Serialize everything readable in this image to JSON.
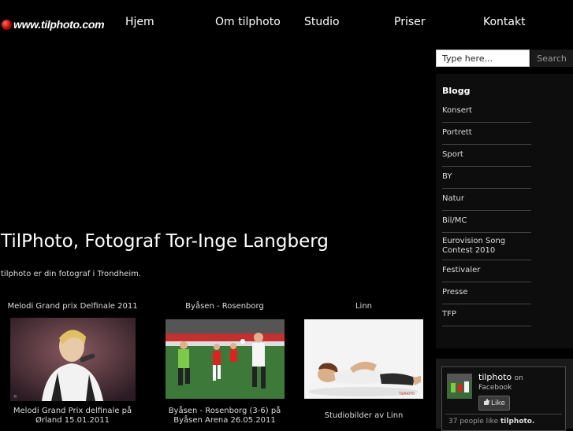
{
  "logo": {
    "text": "www.tilphoto.com"
  },
  "nav": [
    {
      "label": "Hjem"
    },
    {
      "label": "Om tilphoto"
    },
    {
      "label": "Studio"
    },
    {
      "label": "Priser"
    },
    {
      "label": "Kontakt"
    }
  ],
  "search": {
    "placeholder": "Type here...",
    "button_label": "Search"
  },
  "sidebar": {
    "title": "Blogg",
    "categories": [
      {
        "label": "Konsert"
      },
      {
        "label": "Portrett"
      },
      {
        "label": "Sport"
      },
      {
        "label": "BY"
      },
      {
        "label": "Natur"
      },
      {
        "label": "Bil/MC"
      },
      {
        "label": "Eurovision Song Contest 2010"
      },
      {
        "label": "Festivaler"
      },
      {
        "label": "Presse"
      },
      {
        "label": "TFP"
      }
    ]
  },
  "main": {
    "title": "TilPhoto, Fotograf Tor-Inge Langberg",
    "intro": "tilphoto er din fotograf i Trondheim."
  },
  "gallery": [
    {
      "title": "Melodi Grand prix Delfinale 2011",
      "caption": "Melodi Grand Prix delfinale på Ørland 15.01.2011"
    },
    {
      "title": "Byåsen - Rosenborg",
      "caption": "Byåsen - Rosenborg (3-6) på Byåsen Arena 26.05.2011"
    },
    {
      "title": "Linn",
      "caption": "Studiobilder av Linn"
    }
  ],
  "facebook": {
    "page_name": "tilphoto",
    "on_text": "on",
    "network": "Facebook",
    "like_label": "Like",
    "count_text": "37 people like",
    "count_name": "tilphoto."
  }
}
